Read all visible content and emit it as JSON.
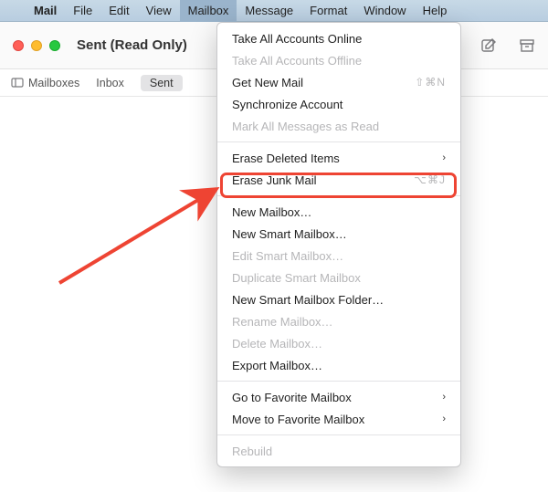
{
  "menubar": {
    "appname": "Mail",
    "items": [
      "File",
      "Edit",
      "View",
      "Mailbox",
      "Message",
      "Format",
      "Window",
      "Help"
    ],
    "active": "Mailbox"
  },
  "window": {
    "title": "Sent (Read Only)"
  },
  "favbar": {
    "mailboxes_label": "Mailboxes",
    "inbox_label": "Inbox",
    "sent_label": "Sent"
  },
  "dropdown": {
    "groups": [
      [
        {
          "label": "Take All Accounts Online",
          "disabled": false
        },
        {
          "label": "Take All Accounts Offline",
          "disabled": true
        },
        {
          "label": "Get New Mail",
          "disabled": false,
          "shortcut": "⇧⌘N"
        },
        {
          "label": "Synchronize Account",
          "disabled": false
        },
        {
          "label": "Mark All Messages as Read",
          "disabled": true
        }
      ],
      [
        {
          "label": "Erase Deleted Items",
          "disabled": false,
          "submenu": true
        },
        {
          "label": "Erase Junk Mail",
          "disabled": false,
          "shortcut": "⌥⌘J",
          "highlight": true
        }
      ],
      [
        {
          "label": "New Mailbox…",
          "disabled": false
        },
        {
          "label": "New Smart Mailbox…",
          "disabled": false
        },
        {
          "label": "Edit Smart Mailbox…",
          "disabled": true
        },
        {
          "label": "Duplicate Smart Mailbox",
          "disabled": true
        },
        {
          "label": "New Smart Mailbox Folder…",
          "disabled": false
        },
        {
          "label": "Rename Mailbox…",
          "disabled": true
        },
        {
          "label": "Delete Mailbox…",
          "disabled": true
        },
        {
          "label": "Export Mailbox…",
          "disabled": false
        }
      ],
      [
        {
          "label": "Go to Favorite Mailbox",
          "disabled": false,
          "submenu": true
        },
        {
          "label": "Move to Favorite Mailbox",
          "disabled": false,
          "submenu": true
        }
      ],
      [
        {
          "label": "Rebuild",
          "disabled": true
        }
      ]
    ]
  },
  "annotation": {
    "highlight_target": "Erase Junk Mail",
    "color": "#ee4433"
  }
}
